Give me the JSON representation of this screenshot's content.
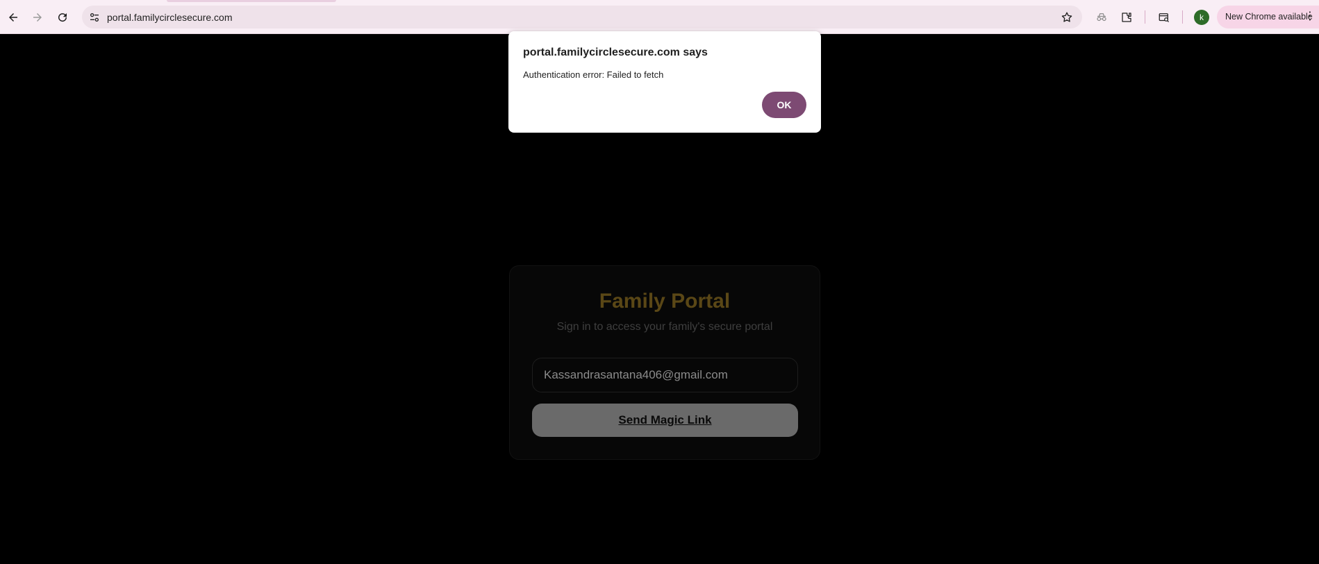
{
  "browser": {
    "url": "portal.familycirclesecure.com",
    "avatar_letter": "k",
    "update_label": "New Chrome available",
    "icons": [
      "back-icon",
      "forward-icon",
      "reload-icon",
      "site-settings-icon",
      "star-icon",
      "incognito-icon",
      "extensions-icon",
      "tab-search-icon",
      "menu-dots-icon"
    ]
  },
  "dialog": {
    "title": "portal.familycirclesecure.com says",
    "message": "Authentication error: Failed to fetch",
    "ok_label": "OK"
  },
  "login": {
    "title": "Family Portal",
    "subtitle": "Sign in to access your family's secure portal",
    "email_value": "Kassandrasantana406@gmail.com",
    "button_label": "Send Magic Link"
  },
  "colors": {
    "accent": "#7d4a73",
    "title_gold": "#5a4716",
    "avatar_green": "#2e6b28"
  }
}
